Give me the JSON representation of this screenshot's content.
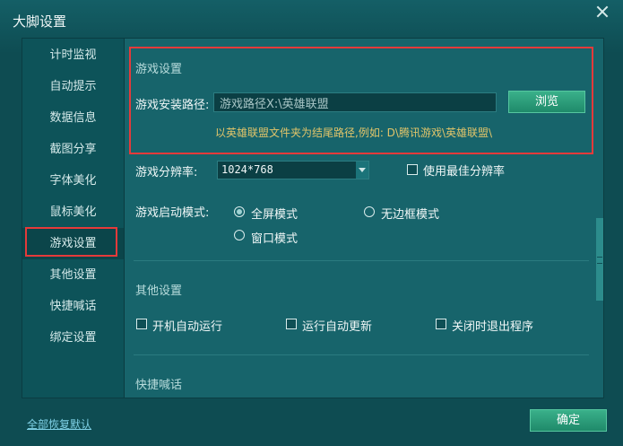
{
  "window": {
    "title": "大脚设置"
  },
  "sidebar": {
    "items": [
      {
        "label": "计时监视"
      },
      {
        "label": "自动提示"
      },
      {
        "label": "数据信息"
      },
      {
        "label": "截图分享"
      },
      {
        "label": "字体美化"
      },
      {
        "label": "鼠标美化"
      },
      {
        "label": "游戏设置",
        "active": true
      },
      {
        "label": "其他设置"
      },
      {
        "label": "快捷喊话"
      },
      {
        "label": "绑定设置"
      }
    ]
  },
  "game_settings": {
    "section_title": "游戏设置",
    "install_path_label": "游戏安装路径:",
    "install_path_value": "游戏路径X:\\英雄联盟",
    "browse_label": "浏览",
    "hint": "以英雄联盟文件夹为结尾路径,例如: D\\腾讯游戏\\英雄联盟\\",
    "resolution_label": "游戏分辨率:",
    "resolution_value": "1024*768",
    "best_resolution_label": "使用最佳分辨率",
    "launch_mode_label": "游戏启动模式:",
    "mode_fullscreen": "全屏模式",
    "mode_borderless": "无边框模式",
    "mode_window": "窗口模式"
  },
  "other_settings": {
    "section_title": "其他设置",
    "autostart_label": "开机自动运行",
    "autoupdate_label": "运行自动更新",
    "exit_on_close_label": "关闭时退出程序"
  },
  "quick_chat": {
    "section_title": "快捷喊话"
  },
  "footer": {
    "reset_label": "全部恢复默认",
    "ok_label": "确定"
  },
  "colors": {
    "background": "#0f4f55",
    "highlight": "#e53a3a",
    "button": "#1f8a6a",
    "hint": "#e0c46a"
  }
}
